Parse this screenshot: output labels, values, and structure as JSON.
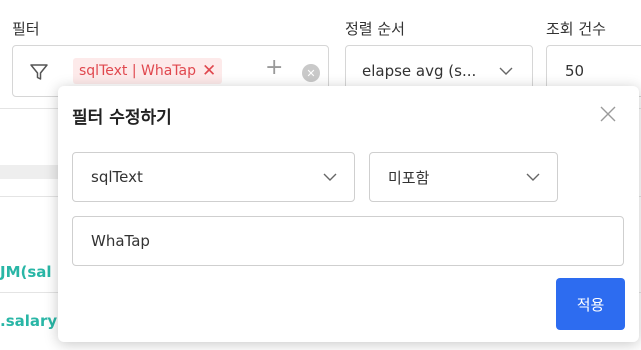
{
  "toolbar": {
    "filter_label": "필터",
    "sort_label": "정렬 순서",
    "count_label": "조회 건수",
    "filter_chip": "sqlText | WhaTap",
    "sort_value": "elapse avg (s...",
    "count_value": "50"
  },
  "background": {
    "cells": [
      "JM(sal",
      ".salary"
    ]
  },
  "dialog": {
    "title": "필터 수정하기",
    "field_select": "sqlText",
    "operator_select": "미포함",
    "value_input": "WhaTap",
    "apply_label": "적용"
  },
  "icons": {
    "filter": "funnel-icon",
    "chip_remove": "close-icon",
    "add": "plus-icon",
    "clear": "clear-circle-icon",
    "dropdown": "chevron-down-icon",
    "dialog_close": "close-icon"
  },
  "colors": {
    "chip_bg": "#fdeaea",
    "chip_text": "#e0484e",
    "accent": "#2d6cf0",
    "teal_text": "#29b6a6"
  }
}
